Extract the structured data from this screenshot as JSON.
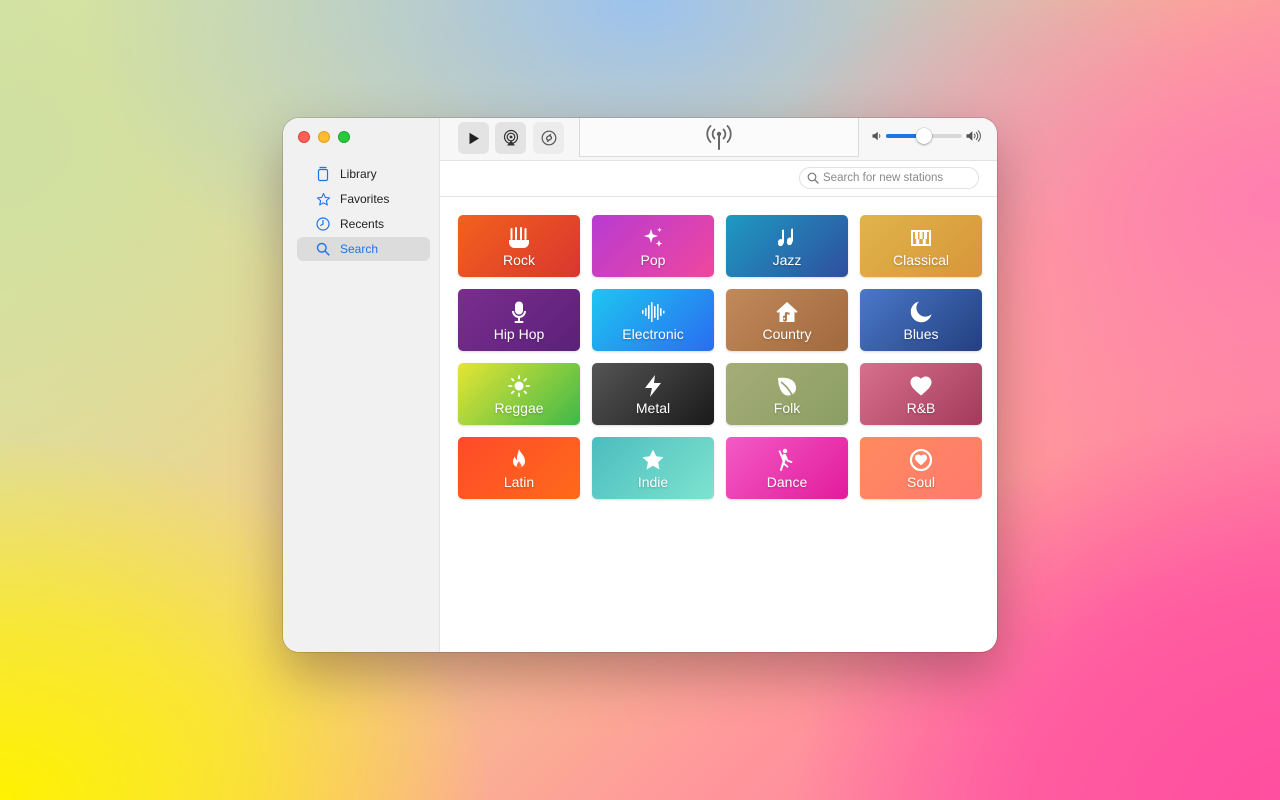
{
  "sidebar": {
    "items": [
      {
        "label": "Library",
        "icon": "library-icon"
      },
      {
        "label": "Favorites",
        "icon": "star-icon"
      },
      {
        "label": "Recents",
        "icon": "clock-icon"
      },
      {
        "label": "Search",
        "icon": "search-icon",
        "active": true
      }
    ]
  },
  "toolbar": {
    "play_icon": "play-icon",
    "airplay_icon": "airplay-icon",
    "shazam_icon": "shazam-icon",
    "now_playing_icon": "broadcast-antenna-icon",
    "volume": {
      "level": 0.5,
      "min_icon": "speaker-low-icon",
      "max_icon": "speaker-high-icon"
    }
  },
  "search": {
    "placeholder": "Search for new stations",
    "value": ""
  },
  "colors": {
    "accent": "#1d74e8"
  },
  "genres": [
    {
      "label": "Rock",
      "icon": "guitars-icon",
      "gradient": [
        "#f2621c",
        "#d9362f"
      ]
    },
    {
      "label": "Pop",
      "icon": "sparkles-icon",
      "gradient": [
        "#b73bd2",
        "#f0479e"
      ]
    },
    {
      "label": "Jazz",
      "icon": "music-notes-icon",
      "gradient": [
        "#1e9ac2",
        "#2f4f9e"
      ]
    },
    {
      "label": "Classical",
      "icon": "piano-keys-icon",
      "gradient": [
        "#e0b44a",
        "#d7963a"
      ]
    },
    {
      "label": "Hip Hop",
      "icon": "microphone-icon",
      "gradient": [
        "#7a2d8f",
        "#5b2178"
      ]
    },
    {
      "label": "Electronic",
      "icon": "waveform-icon",
      "gradient": [
        "#1ec6f0",
        "#2a6cf0"
      ]
    },
    {
      "label": "Country",
      "icon": "house-icon",
      "gradient": [
        "#c18a5a",
        "#a0693e"
      ]
    },
    {
      "label": "Blues",
      "icon": "moon-icon",
      "gradient": [
        "#4a79c8",
        "#233f80"
      ]
    },
    {
      "label": "Reggae",
      "icon": "sun-icon",
      "gradient": [
        "#e6e534",
        "#3db84a"
      ]
    },
    {
      "label": "Metal",
      "icon": "bolt-icon",
      "gradient": [
        "#555555",
        "#1a1a1a"
      ]
    },
    {
      "label": "Folk",
      "icon": "leaf-icon",
      "gradient": [
        "#a6ad78",
        "#8a9e62"
      ]
    },
    {
      "label": "R&B",
      "icon": "heart-icon",
      "gradient": [
        "#d7708c",
        "#a33a5c"
      ]
    },
    {
      "label": "Latin",
      "icon": "flame-icon",
      "gradient": [
        "#ff4a2a",
        "#ff6a1a"
      ]
    },
    {
      "label": "Indie",
      "icon": "star-icon",
      "gradient": [
        "#4bbdbf",
        "#7ee3cf"
      ]
    },
    {
      "label": "Dance",
      "icon": "dancer-icon",
      "gradient": [
        "#f35ac5",
        "#e21b9c"
      ]
    },
    {
      "label": "Soul",
      "icon": "heart-circle-icon",
      "gradient": [
        "#ff8a5e",
        "#ff7a6e"
      ]
    }
  ]
}
